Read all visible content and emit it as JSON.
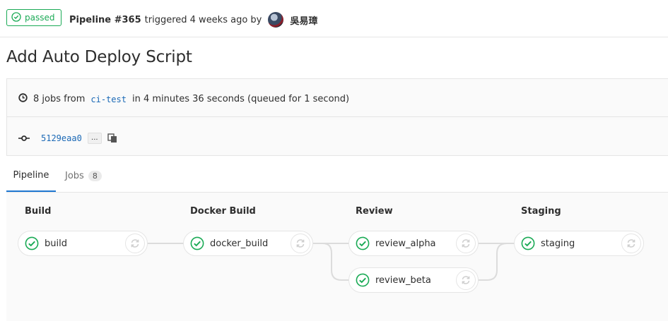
{
  "header": {
    "status": "passed",
    "pipeline_label": "Pipeline #365",
    "triggered_text": "triggered 4 weeks ago by",
    "user_name": "吳易璋"
  },
  "title": "Add Auto Deploy Script",
  "info": {
    "jobs_prefix": "8 jobs from",
    "branch": "ci-test",
    "duration_text": "in 4 minutes 36 seconds (queued for 1 second)",
    "commit_sha": "5129eaa0",
    "ellipsis": "..."
  },
  "tabs": {
    "pipeline_label": "Pipeline",
    "jobs_label": "Jobs",
    "jobs_count": "8"
  },
  "stages": [
    {
      "title": "Build",
      "jobs": [
        "build"
      ]
    },
    {
      "title": "Docker Build",
      "jobs": [
        "docker_build"
      ]
    },
    {
      "title": "Review",
      "jobs": [
        "review_alpha",
        "review_beta"
      ]
    },
    {
      "title": "Staging",
      "jobs": [
        "staging"
      ]
    }
  ],
  "colors": {
    "success": "#1aaa55",
    "link": "#1b69b6",
    "active_tab": "#1f78d1"
  }
}
